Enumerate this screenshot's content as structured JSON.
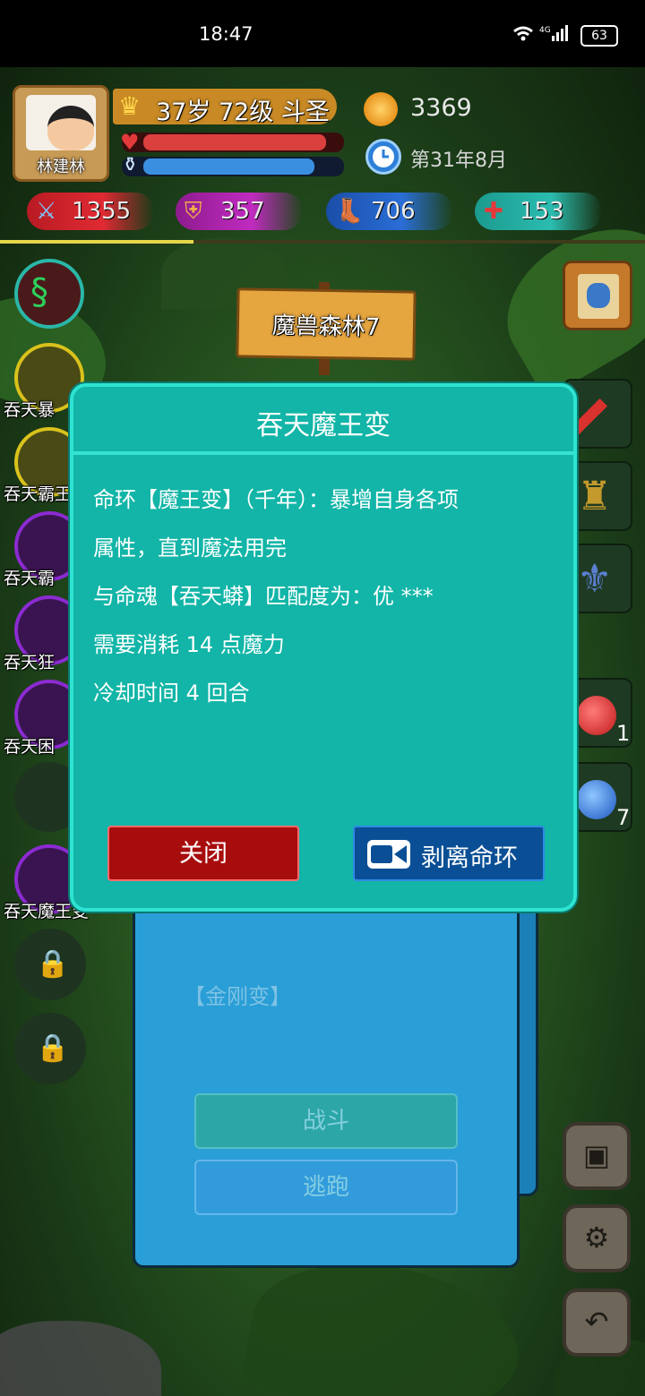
{
  "status_bar": {
    "time": "18:47",
    "network": "4G",
    "battery": "63"
  },
  "player": {
    "name": "林建林",
    "level_text": "37岁 72级 斗圣",
    "hp_fraction": 0.92,
    "mp_fraction": 0.86,
    "gold": "3369",
    "date": "第31年8月"
  },
  "stats": {
    "attack": "1355",
    "defense": "357",
    "speed": "706",
    "heal": "153"
  },
  "exp_fraction": 0.3,
  "location": "魔兽森林7",
  "skills": [
    {
      "label": "",
      "color": "#2ab7a8"
    },
    {
      "label": "吞天暴",
      "color": "#d9c21c"
    },
    {
      "label": "吞天霸王",
      "color": "#d9c21c"
    },
    {
      "label": "吞天霸",
      "color": "#8b2bd1"
    },
    {
      "label": "吞天狂",
      "color": "#8b2bd1"
    },
    {
      "label": "吞天困",
      "color": "#8b2bd1"
    },
    {
      "label": "",
      "color": "#1e3320"
    },
    {
      "label": "吞天魔王变",
      "color": "#8b2bd1"
    }
  ],
  "inventory": {
    "red_potion_count": "1",
    "blue_potion_count": "7"
  },
  "background_panel": {
    "ring_name": "【金刚变】",
    "fight_label": "战斗",
    "flee_label": "逃跑"
  },
  "modal": {
    "title": "吞天魔王变",
    "line1": "命环【魔王变】（千年）：暴增自身各项",
    "line2": "属性，直到魔法用完",
    "line3": "与命魂【吞天蟒】匹配度为：优 ***",
    "line4": "需要消耗 14 点魔力",
    "line5": "冷却时间 4 回合",
    "close_label": "关闭",
    "strip_label": "剥离命环"
  },
  "icons": {
    "crown": "crown-icon",
    "coin": "coin-icon",
    "clock": "clock-icon",
    "save": "save-icon",
    "settings": "gear-icon",
    "back": "back-icon"
  }
}
